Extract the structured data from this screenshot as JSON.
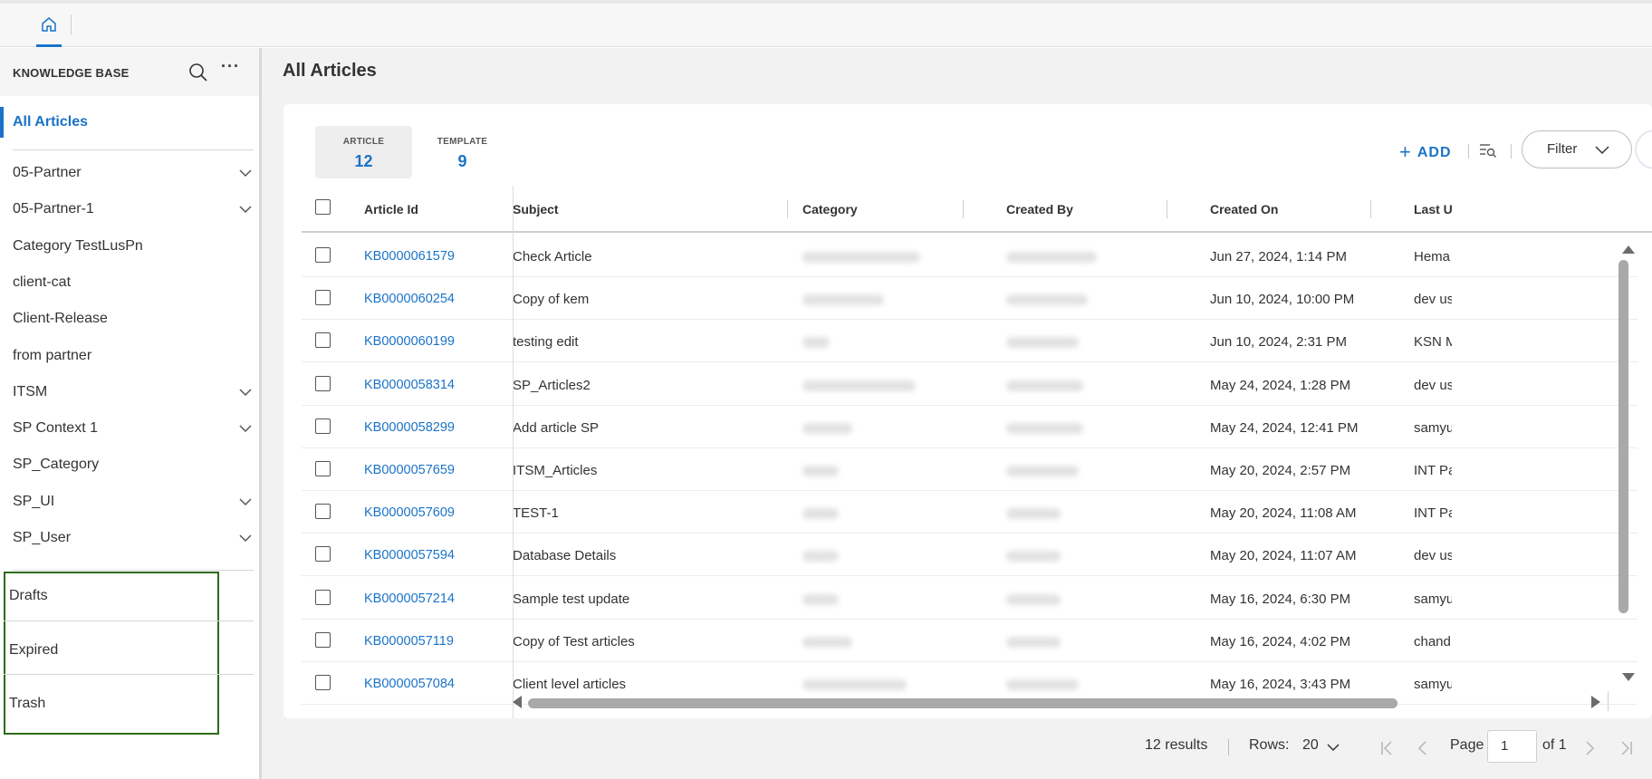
{
  "topbar": {
    "home_tab": "home-icon"
  },
  "sidebar": {
    "title": "KNOWLEDGE BASE",
    "all_articles": "All Articles",
    "categories": [
      {
        "label": "05-Partner",
        "expandable": true
      },
      {
        "label": "05-Partner-1",
        "expandable": true
      },
      {
        "label": "Category TestLusPn",
        "expandable": false
      },
      {
        "label": "client-cat",
        "expandable": false
      },
      {
        "label": "Client-Release",
        "expandable": false
      },
      {
        "label": "from partner",
        "expandable": false
      },
      {
        "label": "ITSM",
        "expandable": true
      },
      {
        "label": "SP Context 1",
        "expandable": true
      },
      {
        "label": "SP_Category",
        "expandable": false
      },
      {
        "label": "SP_UI",
        "expandable": true
      },
      {
        "label": "SP_User",
        "expandable": true
      }
    ],
    "extras": [
      "Drafts",
      "Expired",
      "Trash"
    ]
  },
  "main": {
    "title": "All Articles",
    "tabs": [
      {
        "label": "ARTICLE",
        "count": "12"
      },
      {
        "label": "TEMPLATE",
        "count": "9"
      }
    ],
    "add_label": "ADD",
    "filter_label": "Filter",
    "columns": [
      "Article Id",
      "Subject",
      "Category",
      "Created By",
      "Created On",
      "Last U"
    ],
    "rows": [
      {
        "id": "KB0000061579",
        "subject": "Check Article",
        "created_on": "Jun 27, 2024, 1:14 PM",
        "last": "Hema"
      },
      {
        "id": "KB0000060254",
        "subject": "Copy of kem",
        "created_on": "Jun 10, 2024, 10:00 PM",
        "last": "dev us"
      },
      {
        "id": "KB0000060199",
        "subject": "testing edit",
        "created_on": "Jun 10, 2024, 2:31 PM",
        "last": "KSN M"
      },
      {
        "id": "KB0000058314",
        "subject": "SP_Articles2",
        "created_on": "May 24, 2024, 1:28 PM",
        "last": "dev us"
      },
      {
        "id": "KB0000058299",
        "subject": "Add article SP",
        "created_on": "May 24, 2024, 12:41 PM",
        "last": "samyu"
      },
      {
        "id": "KB0000057659",
        "subject": "ITSM_Articles",
        "created_on": "May 20, 2024, 2:57 PM",
        "last": "INT Pa"
      },
      {
        "id": "KB0000057609",
        "subject": "TEST-1",
        "created_on": "May 20, 2024, 11:08 AM",
        "last": "INT Pa"
      },
      {
        "id": "KB0000057594",
        "subject": "Database Details",
        "created_on": "May 20, 2024, 11:07 AM",
        "last": "dev us"
      },
      {
        "id": "KB0000057214",
        "subject": "Sample test update",
        "created_on": "May 16, 2024, 6:30 PM",
        "last": "samyu"
      },
      {
        "id": "KB0000057119",
        "subject": "Copy of Test articles",
        "created_on": "May 16, 2024, 4:02 PM",
        "last": "chand"
      },
      {
        "id": "KB0000057084",
        "subject": "Client level articles",
        "created_on": "May 16, 2024, 3:43 PM",
        "last": "samyu"
      }
    ]
  },
  "footer": {
    "results": "12 results",
    "rows_label": "Rows:",
    "rows_value": "20",
    "page_label": "Page",
    "page_value": "1",
    "of_label": "of 1"
  }
}
